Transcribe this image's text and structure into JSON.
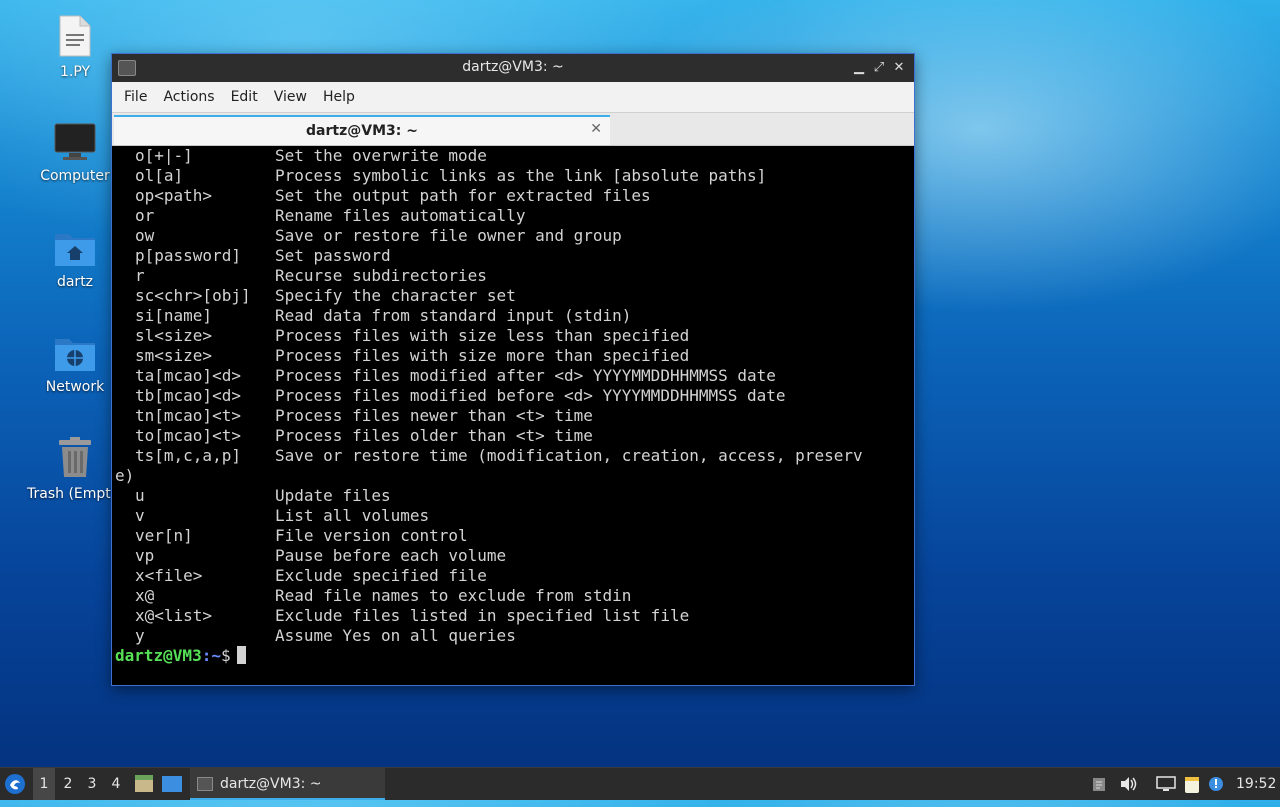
{
  "desktop": {
    "icons": [
      {
        "label": "1.PY",
        "icon": "text-file-icon"
      },
      {
        "label": "Computer",
        "icon": "computer-icon"
      },
      {
        "label": "dartz",
        "icon": "home-folder-icon"
      },
      {
        "label": "Network",
        "icon": "network-folder-icon"
      },
      {
        "label": "Trash (Empty)",
        "icon": "trash-icon"
      }
    ]
  },
  "window": {
    "title": "dartz@VM3: ~",
    "menu": [
      "File",
      "Actions",
      "Edit",
      "View",
      "Help"
    ],
    "tab": {
      "title": "dartz@VM3: ~"
    }
  },
  "terminal": {
    "lines": [
      {
        "opt": "o[+|-]",
        "desc": "Set the overwrite mode"
      },
      {
        "opt": "ol[a]",
        "desc": "Process symbolic links as the link [absolute paths]"
      },
      {
        "opt": "op<path>",
        "desc": "Set the output path for extracted files"
      },
      {
        "opt": "or",
        "desc": "Rename files automatically"
      },
      {
        "opt": "ow",
        "desc": "Save or restore file owner and group"
      },
      {
        "opt": "p[password]",
        "desc": "Set password"
      },
      {
        "opt": "r",
        "desc": "Recurse subdirectories"
      },
      {
        "opt": "sc<chr>[obj]",
        "desc": "Specify the character set"
      },
      {
        "opt": "si[name]",
        "desc": "Read data from standard input (stdin)"
      },
      {
        "opt": "sl<size>",
        "desc": "Process files with size less than specified"
      },
      {
        "opt": "sm<size>",
        "desc": "Process files with size more than specified"
      },
      {
        "opt": "ta[mcao]<d>",
        "desc": "Process files modified after <d> YYYYMMDDHHMMSS date"
      },
      {
        "opt": "tb[mcao]<d>",
        "desc": "Process files modified before <d> YYYYMMDDHHMMSS date"
      },
      {
        "opt": "tn[mcao]<t>",
        "desc": "Process files newer than <t> time"
      },
      {
        "opt": "to[mcao]<t>",
        "desc": "Process files older than <t> time"
      },
      {
        "opt": "ts[m,c,a,p]",
        "desc": "Save or restore time (modification, creation, access, preserv"
      },
      {
        "raw": "e)"
      },
      {
        "opt": "u",
        "desc": "Update files"
      },
      {
        "opt": "v",
        "desc": "List all volumes"
      },
      {
        "opt": "ver[n]",
        "desc": "File version control"
      },
      {
        "opt": "vp",
        "desc": "Pause before each volume"
      },
      {
        "opt": "x<file>",
        "desc": "Exclude specified file"
      },
      {
        "opt": "x@",
        "desc": "Read file names to exclude from stdin"
      },
      {
        "opt": "x@<list>",
        "desc": "Exclude files listed in specified list file"
      },
      {
        "opt": "y",
        "desc": "Assume Yes on all queries"
      }
    ],
    "prompt": {
      "user_host": "dartz@VM3",
      "path": ":~",
      "symbol": "$"
    }
  },
  "taskbar": {
    "workspaces": [
      "1",
      "2",
      "3",
      "4"
    ],
    "active_workspace": "1",
    "task_label": "dartz@VM3: ~",
    "clock": "19:52"
  }
}
